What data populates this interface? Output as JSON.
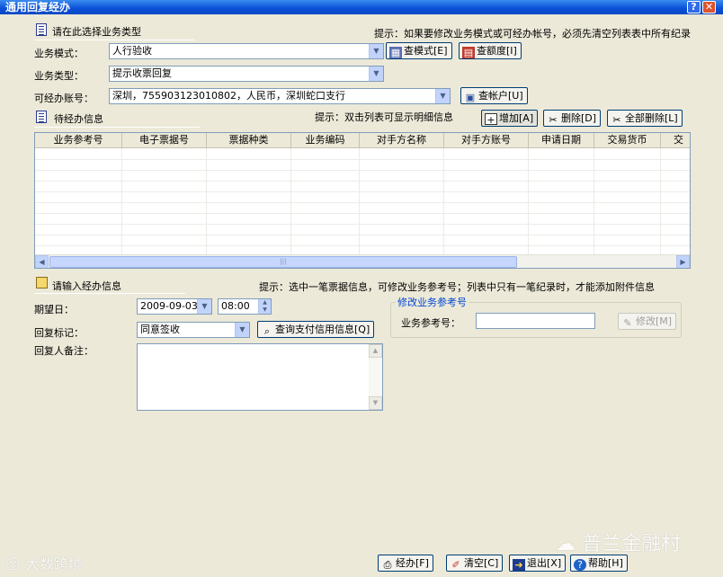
{
  "window": {
    "title": "通用回复经办",
    "help_icon": "?",
    "close_icon": "✕"
  },
  "section_type": {
    "title": "请在此选择业务类型",
    "hint": "提示：如果要修改业务模式或可经办帐号，必须先清空列表表中所有纪录",
    "mode_label": "业务模式：",
    "mode_value": "人行验收",
    "mode_button": "查模式[E]",
    "quota_button": "查额度[I]",
    "type_label": "业务类型：",
    "type_value": "提示收票回复",
    "account_label": "可经办账号：",
    "account_value": "深圳，755903123010802，人民币，深圳蛇口支行",
    "account_button": "查帐户[U]"
  },
  "section_pending": {
    "title": "待经办信息",
    "hint": "提示：双击列表可显示明细信息",
    "add_button": "增加[A]",
    "delete_button": "删除[D]",
    "delete_all_button": "全部删除[L]",
    "columns": [
      "业务参考号",
      "电子票据号",
      "票据种类",
      "业务编码",
      "对手方名称",
      "对手方账号",
      "申请日期",
      "交易货币",
      "交"
    ]
  },
  "section_input": {
    "title": "请输入经办信息",
    "hint": "提示：选中一笔票据信息，可修改业务参考号；列表中只有一笔纪录时，才能添加附件信息",
    "date_label": "期望日：",
    "date_value": "2009-09-03",
    "time_value": "08:00",
    "reply_label": "回复标记：",
    "reply_value": "同意签收",
    "query_button": "查询支付信用信息[Q]",
    "remark_label": "回复人备注：",
    "modify_group_title": "修改业务参考号",
    "ref_label": "业务参考号：",
    "ref_value": "",
    "modify_button": "修改[M]"
  },
  "footer": {
    "submit_button": "经办[F]",
    "clear_button": "清空[C]",
    "exit_button": "退出[X]",
    "help_button": "帮助[H]"
  },
  "watermarks": {
    "left": "大数跨境",
    "right": "普兰金融村"
  }
}
